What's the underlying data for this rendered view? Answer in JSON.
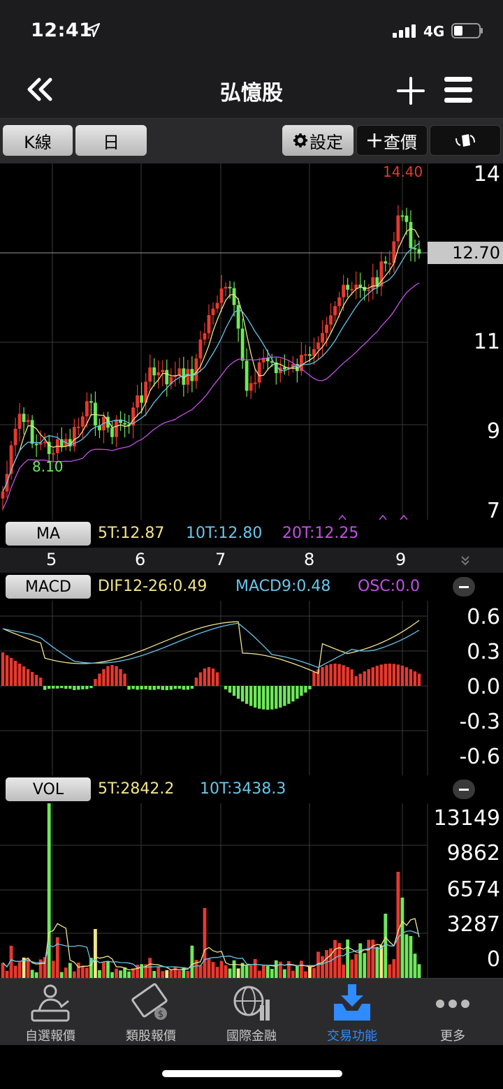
{
  "status": {
    "time": "12:41",
    "network": "4G"
  },
  "header": {
    "title": "弘憶股"
  },
  "toolbar": {
    "kline": "K線",
    "period": "日",
    "settings": "設定",
    "quote": "查價"
  },
  "main_chart": {
    "axis": [
      "14",
      "12.70",
      "11",
      "9",
      "7"
    ],
    "high_label": "14.40",
    "low_label": "8.10",
    "current_price": "12.70"
  },
  "ma": {
    "label": "MA",
    "t5": "5T:12.87",
    "t10": "10T:12.80",
    "t20": "20T:12.25"
  },
  "dates": [
    "5",
    "6",
    "7",
    "8",
    "9"
  ],
  "macd": {
    "label": "MACD",
    "dif": "DIF12-26:0.49",
    "macd9": "MACD9:0.48",
    "osc": "OSC:0.0",
    "axis": [
      "0.6",
      "0.3",
      "0.0",
      "-0.3",
      "-0.6"
    ]
  },
  "vol": {
    "label": "VOL",
    "t5": "5T:2842.2",
    "t10": "10T:3438.3",
    "axis": [
      "13149",
      "9862",
      "6574",
      "3287",
      "0"
    ]
  },
  "tabs": [
    {
      "label": "自選報價",
      "icon": "watchlist-icon"
    },
    {
      "label": "類股報價",
      "icon": "sector-icon"
    },
    {
      "label": "國際金融",
      "icon": "globe-icon"
    },
    {
      "label": "交易功能",
      "icon": "trade-icon"
    },
    {
      "label": "更多",
      "icon": "more-icon"
    }
  ],
  "colors": {
    "up": "#e8382e",
    "down": "#6ee85a",
    "ma5": "#f3e58a",
    "ma10": "#68c6ea",
    "ma20": "#c250e8",
    "active_tab": "#2f8cff"
  }
}
